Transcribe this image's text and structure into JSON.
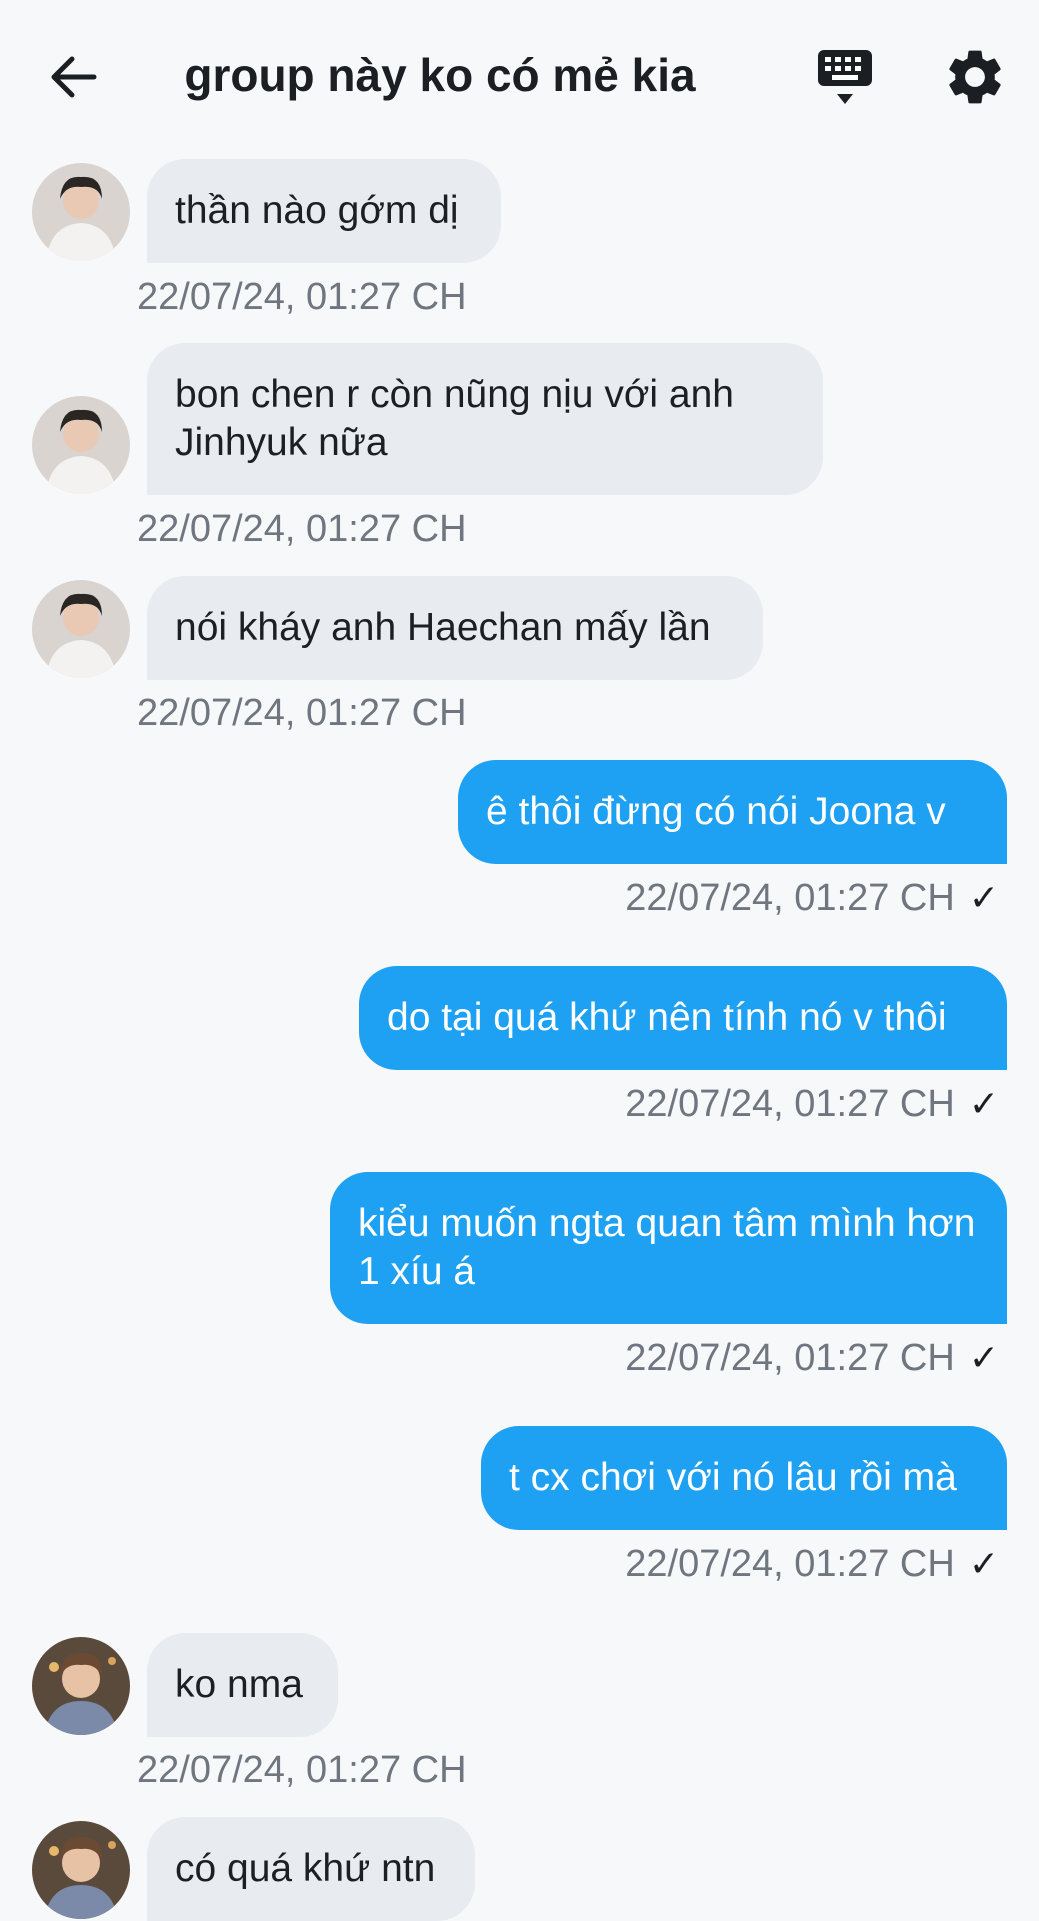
{
  "header": {
    "title": "group này ko có mẻ kia",
    "back_icon": "arrow-left-icon",
    "keyboard_icon": "keyboard-icon",
    "settings_icon": "gear-icon"
  },
  "colors": {
    "incoming_bubble": "#e8ebef",
    "outgoing_bubble": "#1ea1f2",
    "timestamp": "#6f7680"
  },
  "messages": [
    {
      "dir": "in",
      "avatar": "user-a",
      "text": "thần nào gớm dị",
      "time": "22/07/24, 01:27 CH"
    },
    {
      "dir": "in",
      "avatar": "user-a",
      "text": "bon chen r còn nũng nịu với anh Jinhyuk nữa",
      "time": "22/07/24, 01:27 CH"
    },
    {
      "dir": "in",
      "avatar": "user-a",
      "text": "nói kháy anh Haechan mấy lần",
      "time": "22/07/24, 01:27 CH"
    },
    {
      "dir": "out",
      "text": "ê thôi đừng có nói Joona v",
      "time": "22/07/24, 01:27 CH",
      "status": "✓"
    },
    {
      "dir": "out",
      "text": "do tại quá khứ nên tính nó v thôi",
      "time": "22/07/24, 01:27 CH",
      "status": "✓"
    },
    {
      "dir": "out",
      "text": "kiểu muốn ngta quan tâm mình hơn 1 xíu á",
      "time": "22/07/24, 01:27 CH",
      "status": "✓"
    },
    {
      "dir": "out",
      "text": "t cx chơi với nó lâu rồi mà",
      "time": "22/07/24, 01:27 CH",
      "status": "✓"
    },
    {
      "dir": "in",
      "avatar": "user-b",
      "text": "ko nma",
      "time": "22/07/24, 01:27 CH"
    },
    {
      "dir": "in",
      "avatar": "user-b",
      "text": "có quá khứ ntn",
      "time": ""
    }
  ]
}
